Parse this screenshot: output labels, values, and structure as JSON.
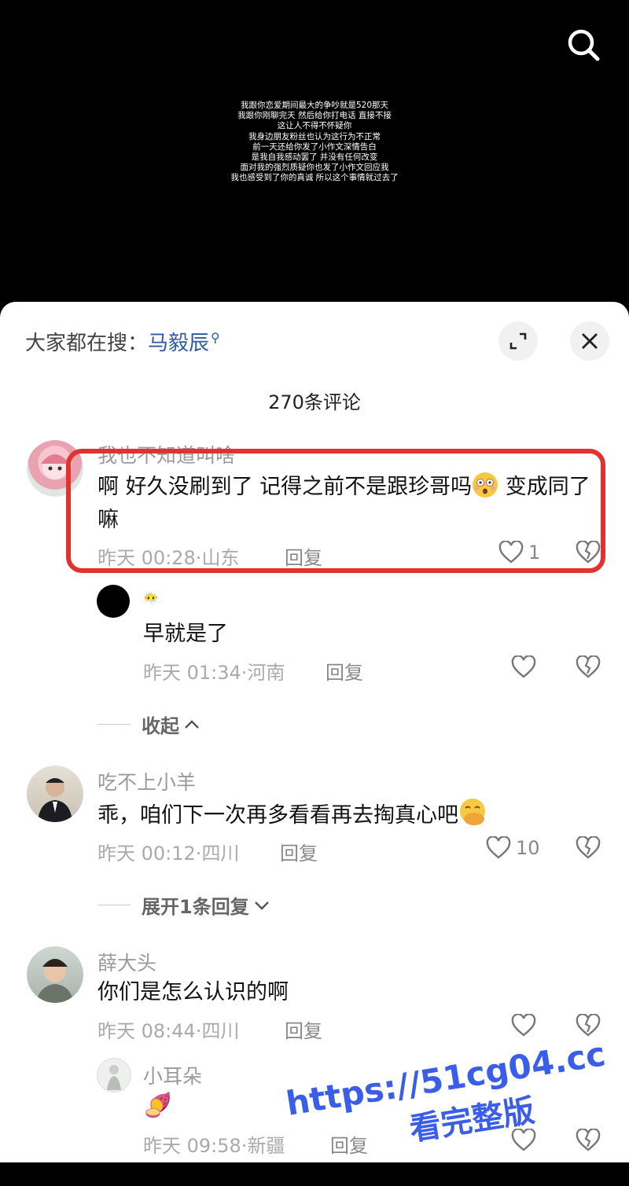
{
  "video": {
    "subtitle_lines": [
      "我跟你恋爱期间最大的争吵就是520那天",
      "我跟你刚聊完天 然后给你打电话 直接不接",
      "这让人不得不怀疑你",
      "我身边朋友粉丝也认为这行为不正常",
      "前一天还给你发了小作文深情告白",
      "是我自我感动罢了 并没有任何改变",
      "面对我的强烈质疑你也发了小作文回应我",
      "我也感受到了你的真诚 所以这个事情就过去了"
    ],
    "search_icon": "search-icon"
  },
  "sheet": {
    "hot_search_label": "大家都在搜：",
    "hot_search_keyword": "马毅辰",
    "comment_count": "270条评论",
    "expand_icon": "expand-icon",
    "close_icon": "close-icon"
  },
  "comments": [
    {
      "username": "我也不知道叫啥",
      "text": "啊 好久没刷到了 记得之前不是跟珍哥吗",
      "text_tail": " 变成同了嘛",
      "emoji": "flushed-face-emoji",
      "time": "昨天 00:28",
      "location": "山东",
      "reply_label": "回复",
      "likes": "1",
      "reply": {
        "username": "😶‍🌫️",
        "text": "早就是了",
        "time": "昨天 01:34",
        "location": "河南",
        "reply_label": "回复"
      },
      "thread_toggle": "收起"
    },
    {
      "username": "吃不上小羊",
      "text": "乖，咱们下一次再多看看再去掏真心吧",
      "emoji": "hand-over-mouth-emoji",
      "time": "昨天 00:12",
      "location": "四川",
      "reply_label": "回复",
      "likes": "10",
      "thread_toggle": "展开1条回复"
    },
    {
      "username": "薛大头",
      "text": "你们是怎么认识的啊",
      "time": "昨天 08:44",
      "location": "四川",
      "reply_label": "回复",
      "reply": {
        "username": "小耳朵",
        "text": "🍠",
        "time": "昨天 09:58",
        "location": "新疆",
        "reply_label": "回复"
      }
    }
  ],
  "watermark": {
    "url": "https://51cg04.cc",
    "caption": "看完整版"
  },
  "colors": {
    "highlight_border": "#e0332f",
    "keyword": "#2f5b9e",
    "watermark": "#3a5ee8"
  }
}
